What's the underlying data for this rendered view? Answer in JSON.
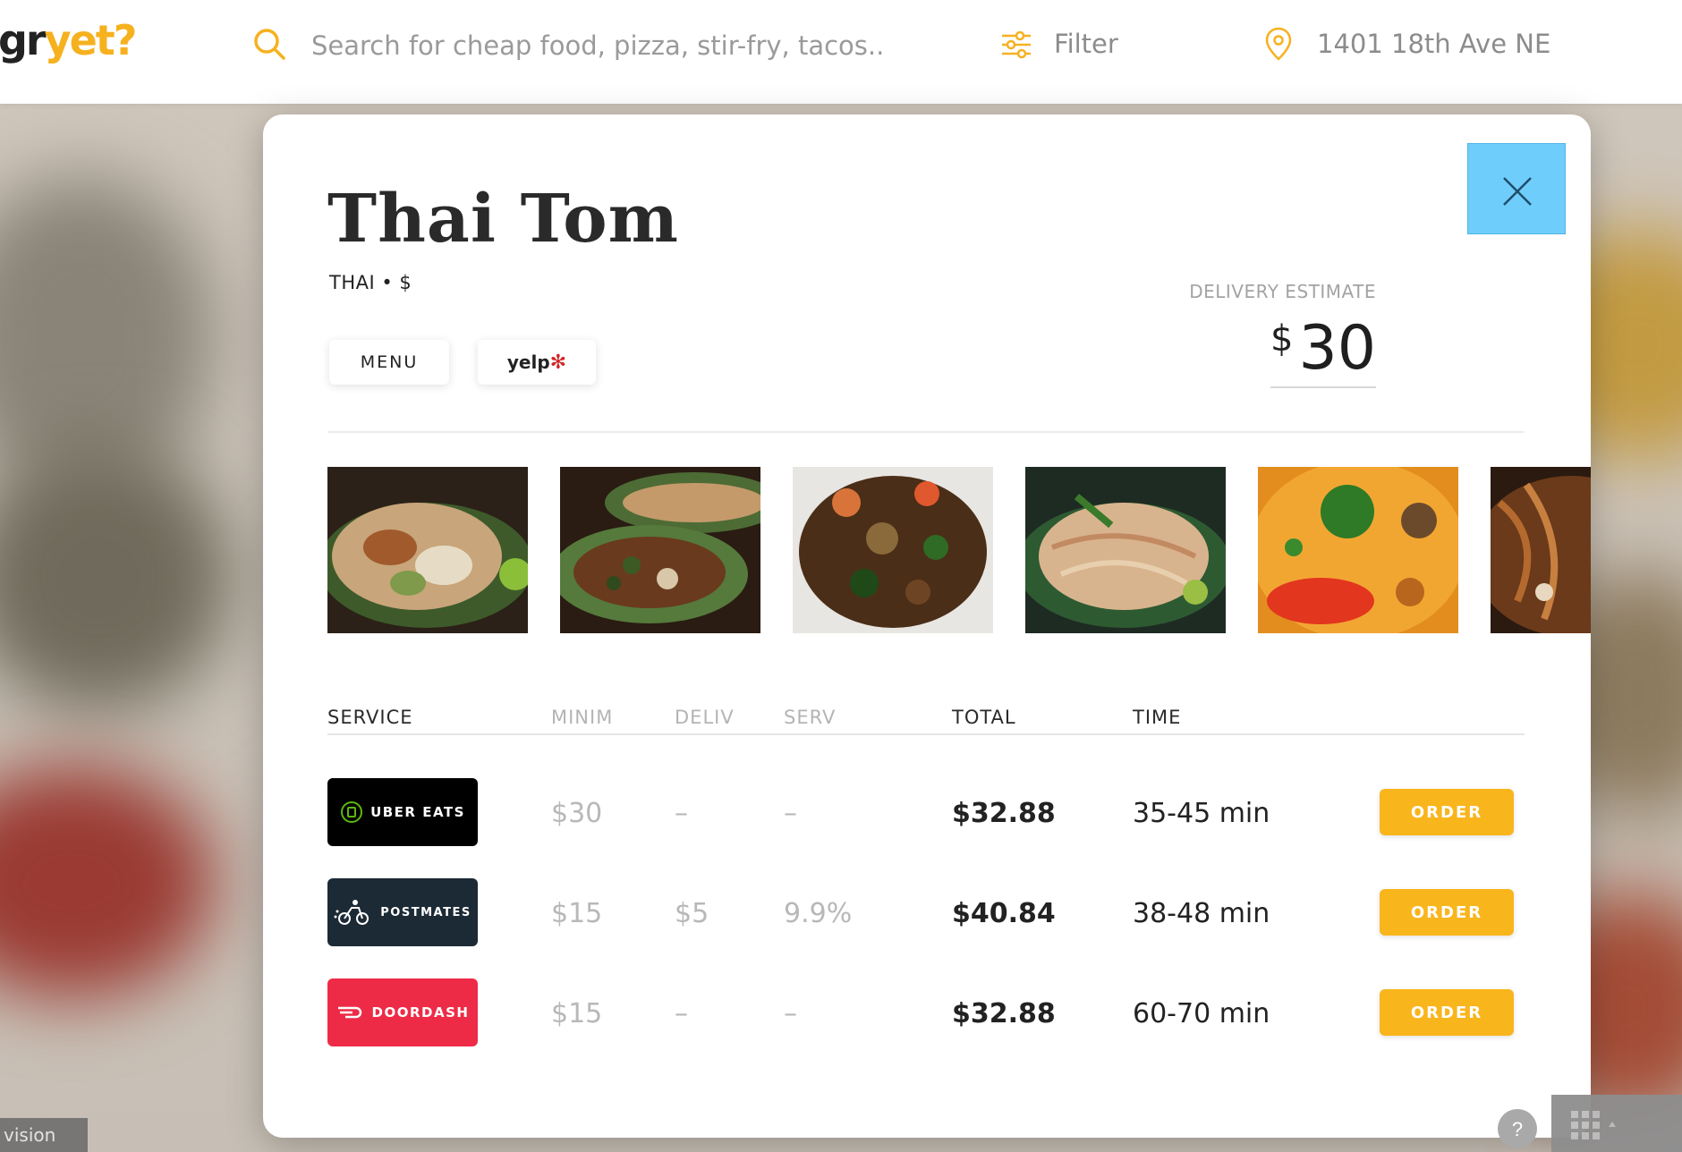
{
  "header": {
    "logo_prefix": "gr",
    "logo_accent": "yet?",
    "search_placeholder": "Search for cheap food, pizza, stir-fry, tacos...",
    "filter_label": "Filter",
    "address": "1401 18th Ave NE"
  },
  "restaurant": {
    "name": "Thai Tom",
    "subtitle": "THAI • $",
    "menu_label": "MENU",
    "yelp_label": "yelp"
  },
  "estimate": {
    "label": "DELIVERY ESTIMATE",
    "currency": "$",
    "value": "30"
  },
  "photos": [
    {
      "name": "fried-rice-photo"
    },
    {
      "name": "basil-stirfry-photo"
    },
    {
      "name": "shrimp-noodles-photo"
    },
    {
      "name": "pad-thai-photo"
    },
    {
      "name": "tom-yum-soup-photo"
    },
    {
      "name": "noodles-partial-photo"
    }
  ],
  "table": {
    "headers": {
      "service": "SERVICE",
      "minimum": "MINIM",
      "delivery": "DELIV",
      "service_fee": "SERV",
      "total": "TOTAL",
      "time": "TIME"
    },
    "rows": [
      {
        "service": "UBER EATS",
        "minimum": "$30",
        "delivery": "–",
        "service_fee": "–",
        "total": "$32.88",
        "time": "35-45 min",
        "order_label": "ORDER",
        "color": "#000000"
      },
      {
        "service": "POSTMATES",
        "minimum": "$15",
        "delivery": "$5",
        "service_fee": "9.9%",
        "total": "$40.84",
        "time": "38-48 min",
        "order_label": "ORDER",
        "color": "#1c2a36"
      },
      {
        "service": "DOORDASH",
        "minimum": "$15",
        "delivery": "–",
        "service_fee": "–",
        "total": "$32.88",
        "time": "60-70 min",
        "order_label": "ORDER",
        "color": "#ee2b47"
      }
    ]
  },
  "footer": {
    "invision_label": "vision",
    "help_label": "?"
  },
  "colors": {
    "accent": "#f9b51c",
    "close_button": "#6fcdfb"
  }
}
